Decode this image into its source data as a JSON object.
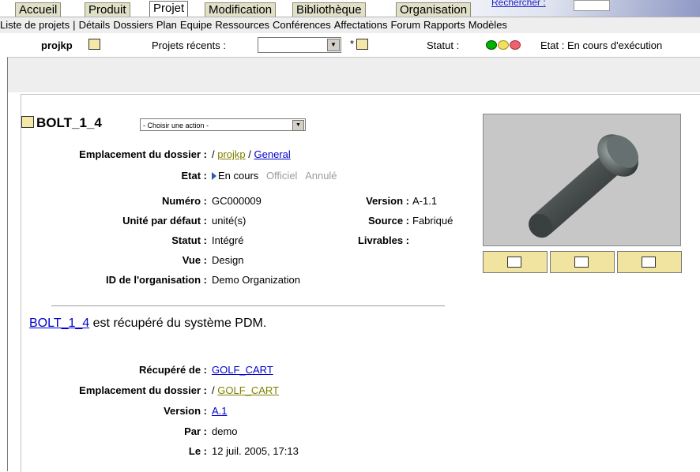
{
  "tabs": [
    "Accueil",
    "Produit",
    "Projet",
    "Modification",
    "Bibliothèque",
    "Organisation"
  ],
  "active_tab": "Projet",
  "search_link": "Rechercher :",
  "nav_items": [
    "Liste de projets",
    "|",
    "Détails",
    "Dossiers",
    "Plan",
    "Equipe",
    "Ressources",
    "Conférences",
    "Affectations",
    "Forum",
    "Rapports",
    "Modèles"
  ],
  "project": {
    "name": "projkp",
    "recent_label": "Projets récents :",
    "recent_value": "",
    "status_label": "Statut :",
    "status_colors": [
      "#00b000",
      "#f0e060",
      "#f06070"
    ],
    "etat_text": "Etat : En cours d'exécution"
  },
  "object": {
    "title": "BOLT_1_4",
    "action_select": "- Choisir une action -",
    "location_label": "Emplacement du dossier :",
    "location_prefix": "/",
    "location_link1": "projkp",
    "location_sep": "/",
    "location_link2": "General",
    "etat_label": "Etat :",
    "etat_current": "En cours",
    "etat_official": "Officiel",
    "etat_cancelled": "Annulé",
    "fields_left": [
      {
        "label": "Numéro :",
        "value": "GC000009"
      },
      {
        "label": "Unité par défaut :",
        "value": "unité(s)"
      },
      {
        "label": "Statut :",
        "value": "Intégré"
      },
      {
        "label": "Vue :",
        "value": "Design"
      },
      {
        "label": "ID de l'organisation :",
        "value": "Demo Organization"
      }
    ],
    "fields_right": [
      {
        "label": "Version :",
        "value": "A-1.1"
      },
      {
        "label": "Source :",
        "value": "Fabriqué"
      },
      {
        "label": "Livrables :",
        "value": ""
      }
    ]
  },
  "message": {
    "link": "BOLT_1_4",
    "text": "est récupéré du système PDM."
  },
  "retrieved": {
    "from_label": "Récupéré de :",
    "from_link": "GOLF_CART",
    "location_label": "Emplacement du dossier :",
    "location_prefix": "/",
    "location_link": "GOLF_CART",
    "version_label": "Version :",
    "version_link": "A.1",
    "by_label": "Par :",
    "by_value": "demo",
    "date_label": "Le :",
    "date_value": "12 juil. 2005, 17:13"
  },
  "icons": [
    "folder-icon",
    "new-folder-icon",
    "checkout-icon",
    "print-icon",
    "properties-icon"
  ]
}
